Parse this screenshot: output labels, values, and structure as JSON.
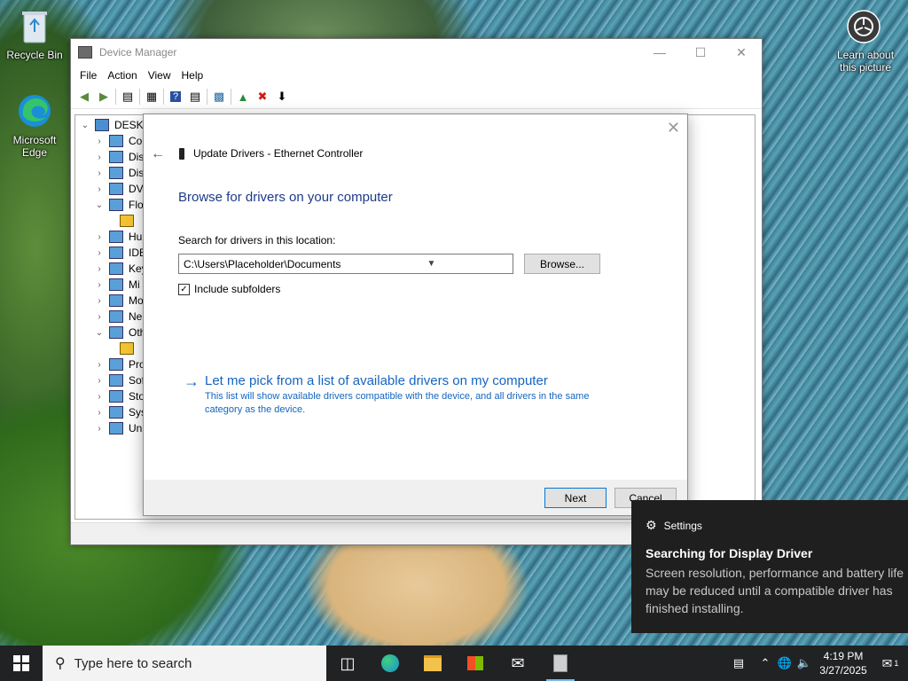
{
  "desktop": {
    "icons": [
      {
        "label": "Recycle Bin",
        "icon": "recycle-bin-icon"
      },
      {
        "label": "Microsoft Edge",
        "icon": "edge-icon"
      },
      {
        "label": "Learn about this picture",
        "icon": "camera-icon"
      }
    ]
  },
  "device_manager": {
    "title": "Device Manager",
    "menu": [
      "File",
      "Action",
      "View",
      "Help"
    ],
    "tree": {
      "root": "DESKT",
      "items": [
        {
          "label": "Co",
          "expanded": false
        },
        {
          "label": "Dis",
          "expanded": false
        },
        {
          "label": "Dis",
          "expanded": false
        },
        {
          "label": "DV",
          "expanded": false
        },
        {
          "label": "Flo",
          "expanded": true
        },
        {
          "label": "",
          "expanded": null
        },
        {
          "label": "Hu",
          "expanded": false
        },
        {
          "label": "IDE",
          "expanded": false
        },
        {
          "label": "Key",
          "expanded": false
        },
        {
          "label": "Mi",
          "expanded": false
        },
        {
          "label": "Mo",
          "expanded": false
        },
        {
          "label": "Ne",
          "expanded": false
        },
        {
          "label": "Oth",
          "expanded": true
        },
        {
          "label": "",
          "expanded": null
        },
        {
          "label": "Pro",
          "expanded": false
        },
        {
          "label": "Sof",
          "expanded": false
        },
        {
          "label": "Sto",
          "expanded": false
        },
        {
          "label": "Sys",
          "expanded": false
        },
        {
          "label": "Uni",
          "expanded": false
        }
      ]
    }
  },
  "dialog": {
    "title": "Update Drivers - Ethernet Controller",
    "heading": "Browse for drivers on your computer",
    "search_label": "Search for drivers in this location:",
    "path_value": "C:\\Users\\Placeholder\\Documents",
    "browse_label": "Browse...",
    "include_subfolders_label": "Include subfolders",
    "include_subfolders_checked": true,
    "pick_title": "Let me pick from a list of available drivers on my computer",
    "pick_desc": "This list will show available drivers compatible with the device, and all drivers in the same category as the device.",
    "next_label": "Next",
    "cancel_label": "Cancel"
  },
  "toast": {
    "app": "Settings",
    "title": "Searching for Display Driver",
    "body": "Screen resolution, performance and battery life may be reduced until a compatible driver has finished installing."
  },
  "taskbar": {
    "search_placeholder": "Type here to search",
    "time": "4:19 PM",
    "date": "3/27/2025",
    "notification_count": "1"
  },
  "colors": {
    "accent": "#1565c0",
    "heading": "#1e3a8a",
    "taskbar": "#202224",
    "toast": "#1f1f1f"
  }
}
